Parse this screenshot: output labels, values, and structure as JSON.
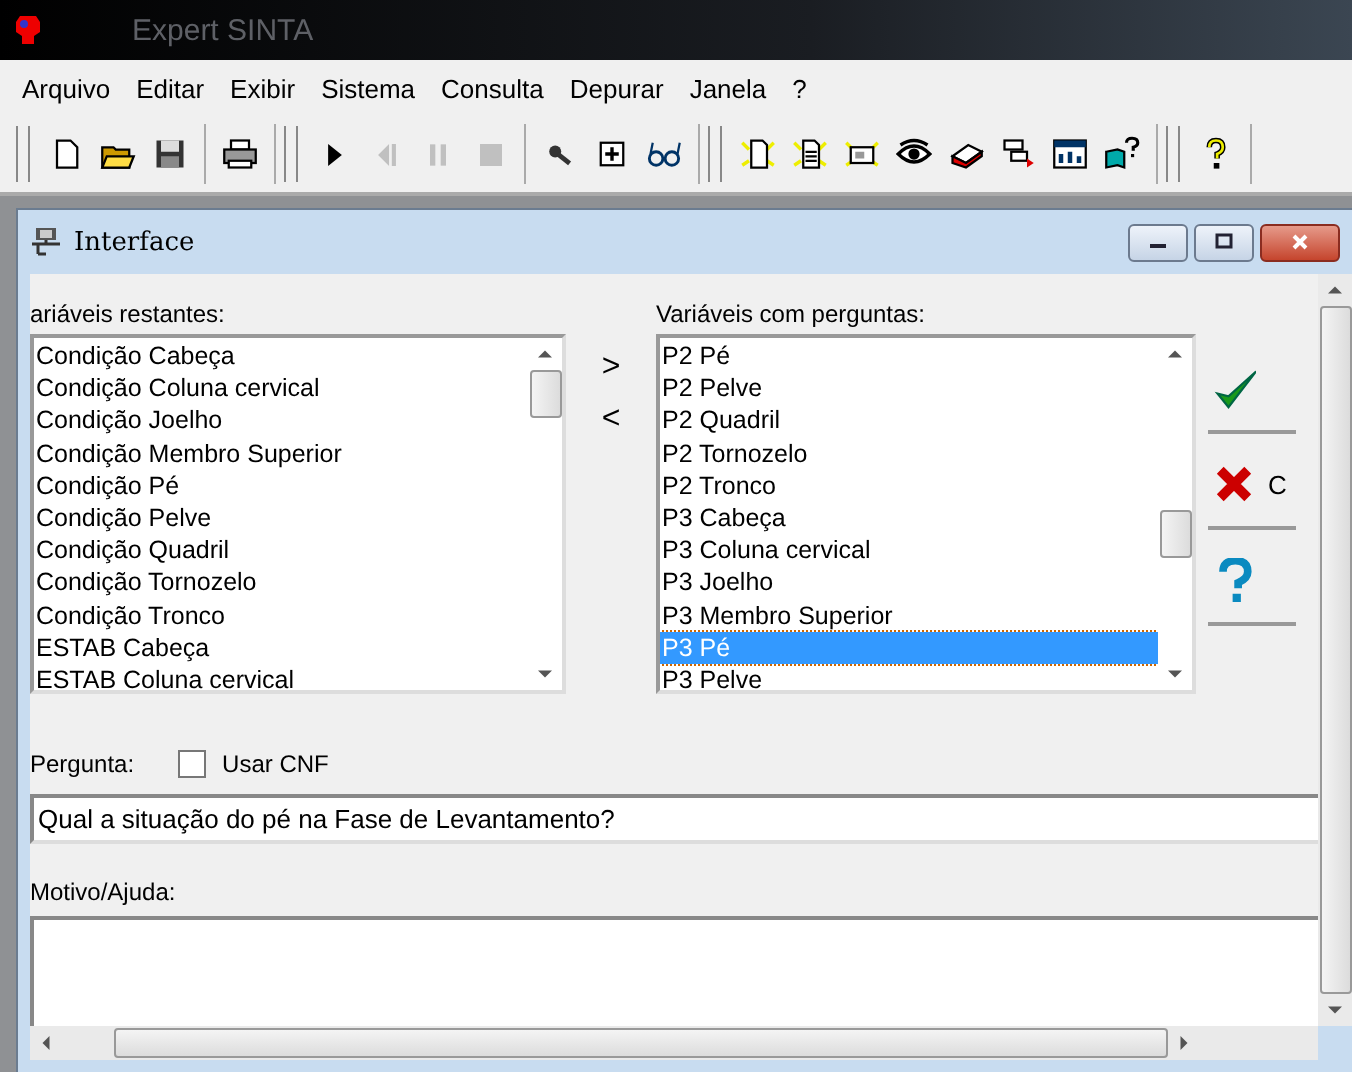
{
  "window": {
    "title": "Expert SINTA"
  },
  "menu": [
    "Arquivo",
    "Editar",
    "Exibir",
    "Sistema",
    "Consulta",
    "Depurar",
    "Janela",
    "?"
  ],
  "toolbar": [
    [
      {
        "kind": "new",
        "disabled": false
      },
      {
        "kind": "open",
        "disabled": false
      },
      {
        "kind": "save",
        "disabled": false
      }
    ],
    [
      {
        "kind": "print",
        "disabled": false
      }
    ],
    [
      {
        "kind": "play",
        "disabled": false
      },
      {
        "kind": "step",
        "disabled": true
      },
      {
        "kind": "pause",
        "disabled": true
      },
      {
        "kind": "stop",
        "disabled": true
      }
    ],
    [
      {
        "kind": "probe",
        "disabled": false
      },
      {
        "kind": "expand",
        "disabled": false
      },
      {
        "kind": "glasses",
        "disabled": false
      }
    ],
    [
      {
        "kind": "newdoc",
        "disabled": false
      },
      {
        "kind": "doc",
        "disabled": false
      },
      {
        "kind": "card",
        "disabled": false
      },
      {
        "kind": "eye",
        "disabled": false
      },
      {
        "kind": "stack",
        "disabled": false
      },
      {
        "kind": "winarrow",
        "disabled": false
      },
      {
        "kind": "chartwin",
        "disabled": false
      },
      {
        "kind": "bookhelp",
        "disabled": false
      }
    ],
    [
      {
        "kind": "help",
        "disabled": false
      }
    ]
  ],
  "child": {
    "title": "Interface"
  },
  "left_list": {
    "label": "ariáveis restantes:",
    "items": [
      {
        "text": "Condição Cabeça",
        "selected": false
      },
      {
        "text": "Condição Coluna cervical",
        "selected": false
      },
      {
        "text": "Condição Joelho",
        "selected": false
      },
      {
        "text": "Condição Membro Superior",
        "selected": false
      },
      {
        "text": "Condição Pé",
        "selected": false
      },
      {
        "text": "Condição Pelve",
        "selected": false
      },
      {
        "text": "Condição Quadril",
        "selected": false
      },
      {
        "text": "Condição Tornozelo",
        "selected": false
      },
      {
        "text": "Condição Tronco",
        "selected": false
      },
      {
        "text": "ESTAB Cabeça",
        "selected": false
      },
      {
        "text": "ESTAB Coluna cervical",
        "selected": false
      }
    ]
  },
  "move_buttons": [
    ">",
    "<"
  ],
  "right_list": {
    "label": "Variáveis com perguntas:",
    "items": [
      {
        "text": "P2 Pé",
        "selected": false
      },
      {
        "text": "P2 Pelve",
        "selected": false
      },
      {
        "text": "P2 Quadril",
        "selected": false
      },
      {
        "text": "P2 Tornozelo",
        "selected": false
      },
      {
        "text": "P2 Tronco",
        "selected": false
      },
      {
        "text": "P3 Cabeça",
        "selected": false
      },
      {
        "text": "P3 Coluna cervical",
        "selected": false
      },
      {
        "text": "P3 Joelho",
        "selected": false
      },
      {
        "text": "P3 Membro Superior",
        "selected": false
      },
      {
        "text": "P3 Pé",
        "selected": true
      },
      {
        "text": "P3 Pelve",
        "selected": false
      }
    ]
  },
  "action_buttons": [
    {
      "kind": "ok"
    },
    {
      "kind": "cancel",
      "label": "C"
    },
    {
      "kind": "help"
    }
  ],
  "question": {
    "label": "Pergunta:",
    "checkbox": {
      "label": "Usar CNF",
      "checked": false
    },
    "value": "Qual a situação do pé na Fase de Levantamento?"
  },
  "reason": {
    "label": "Motivo/Ajuda:"
  }
}
